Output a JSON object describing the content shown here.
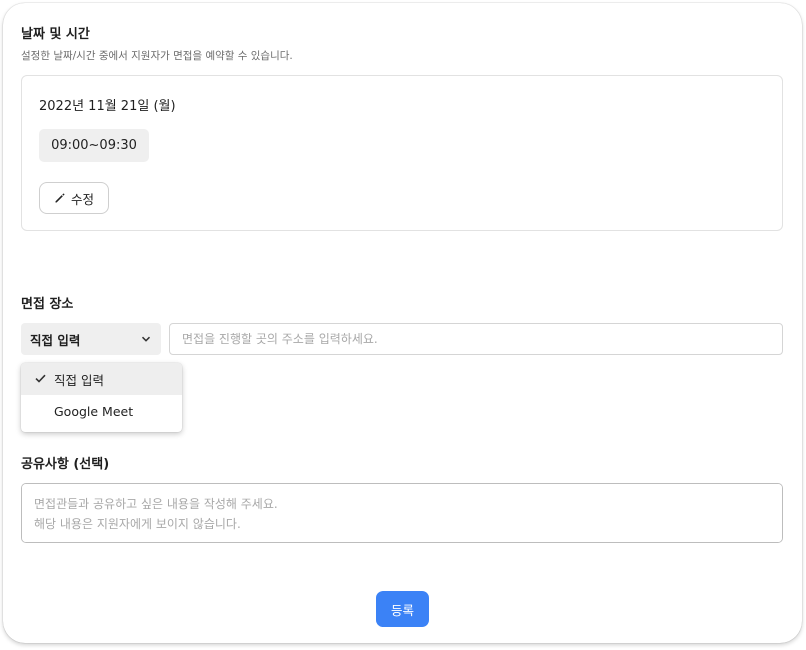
{
  "datetime": {
    "title": "날짜 및 시간",
    "description": "설정한 날짜/시간 중에서 지원자가 면접을 예약할 수 있습니다.",
    "date": "2022년 11월 21일 (월)",
    "time_slot": "09:00~09:30",
    "edit_label": "수정"
  },
  "location": {
    "title": "면접 장소",
    "select_value": "직접 입력",
    "address_placeholder": "면접을 진행할 곳의 주소를 입력하세요.",
    "options": [
      {
        "label": "직접 입력",
        "selected": true
      },
      {
        "label": "Google Meet",
        "selected": false
      }
    ]
  },
  "notes": {
    "title": "공유사항 (선택)",
    "placeholder": "면접관들과 공유하고 싶은 내용을 작성해 주세요.\n해당 내용은 지원자에게 보이지 않습니다."
  },
  "submit_label": "등록",
  "colors": {
    "accent": "#3b82f6",
    "chip_bg": "#efefef"
  },
  "icons": {
    "edit": "pencil-icon",
    "select": "chevron-down-icon",
    "selected_option": "check-icon"
  }
}
